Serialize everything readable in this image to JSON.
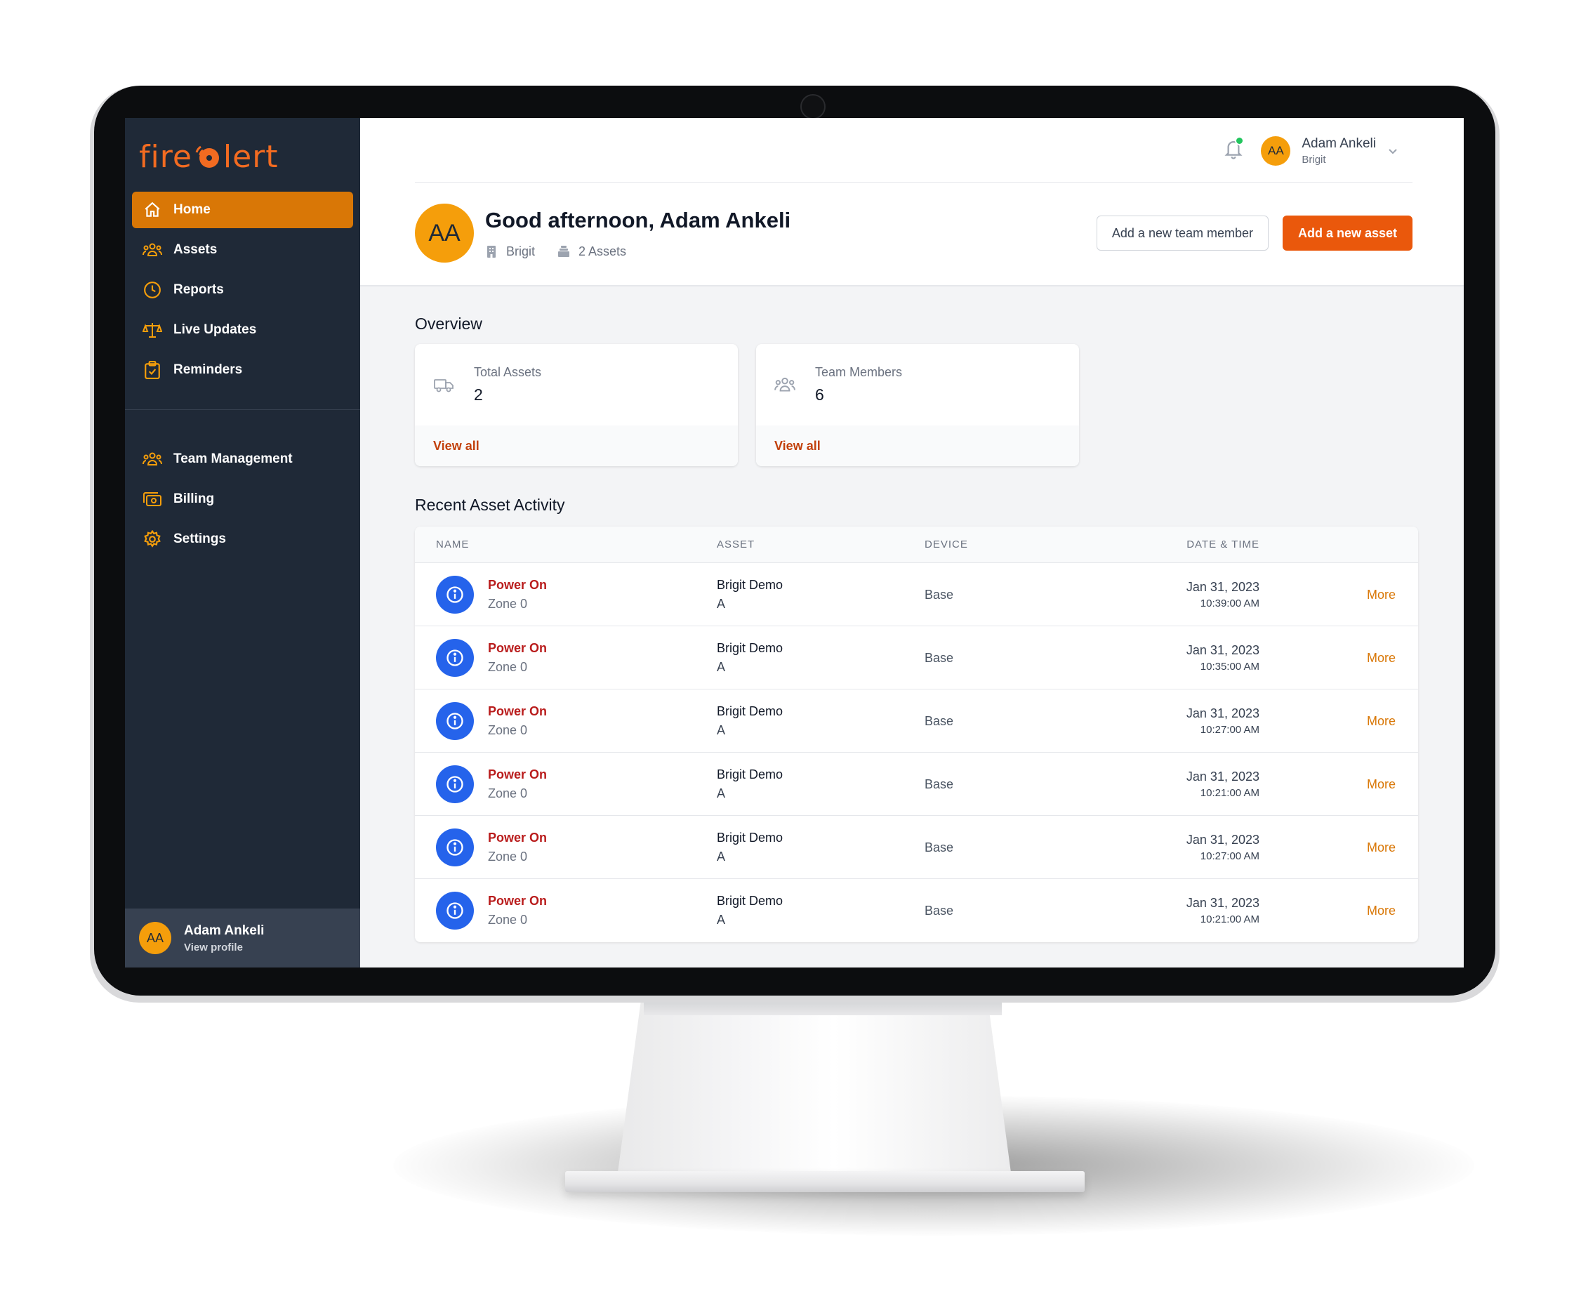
{
  "app": {
    "logo_text_left": "fire",
    "logo_text_right": "lert"
  },
  "sidebar": {
    "items": [
      {
        "label": "Home",
        "icon": "home-icon"
      },
      {
        "label": "Assets",
        "icon": "users-icon"
      },
      {
        "label": "Reports",
        "icon": "clock-icon"
      },
      {
        "label": "Live Updates",
        "icon": "scale-icon"
      },
      {
        "label": "Reminders",
        "icon": "clipboard-icon"
      }
    ],
    "items2": [
      {
        "label": "Team Management",
        "icon": "users-icon"
      },
      {
        "label": "Billing",
        "icon": "cash-icon"
      },
      {
        "label": "Settings",
        "icon": "gear-icon"
      }
    ],
    "user": {
      "initials": "AA",
      "name": "Adam Ankeli",
      "link": "View profile"
    }
  },
  "topbar": {
    "user": {
      "initials": "AA",
      "name": "Adam Ankeli",
      "org": "Brigit"
    }
  },
  "header": {
    "initials": "AA",
    "greeting": "Good afternoon, Adam Ankeli",
    "org": "Brigit",
    "assets_count": "2 Assets",
    "btn_team": "Add a new team member",
    "btn_asset": "Add a new asset"
  },
  "overview": {
    "title": "Overview",
    "cards": [
      {
        "label": "Total Assets",
        "value": "2",
        "link": "View all"
      },
      {
        "label": "Team Members",
        "value": "6",
        "link": "View all"
      }
    ]
  },
  "activity": {
    "title": "Recent Asset Activity",
    "columns": [
      "NAME",
      "ASSET",
      "DEVICE",
      "DATE & TIME"
    ],
    "rows": [
      {
        "event": "Power On",
        "zone": "Zone 0",
        "asset": "Brigit Demo",
        "asset_sub": "A",
        "device": "Base",
        "date": "Jan 31, 2023",
        "time": "10:39:00 AM",
        "more": "More"
      },
      {
        "event": "Power On",
        "zone": "Zone 0",
        "asset": "Brigit Demo",
        "asset_sub": "A",
        "device": "Base",
        "date": "Jan 31, 2023",
        "time": "10:35:00 AM",
        "more": "More"
      },
      {
        "event": "Power On",
        "zone": "Zone 0",
        "asset": "Brigit Demo",
        "asset_sub": "A",
        "device": "Base",
        "date": "Jan 31, 2023",
        "time": "10:27:00 AM",
        "more": "More"
      },
      {
        "event": "Power On",
        "zone": "Zone 0",
        "asset": "Brigit Demo",
        "asset_sub": "A",
        "device": "Base",
        "date": "Jan 31, 2023",
        "time": "10:21:00 AM",
        "more": "More"
      },
      {
        "event": "Power On",
        "zone": "Zone 0",
        "asset": "Brigit Demo",
        "asset_sub": "A",
        "device": "Base",
        "date": "Jan 31, 2023",
        "time": "10:27:00 AM",
        "more": "More"
      },
      {
        "event": "Power On",
        "zone": "Zone 0",
        "asset": "Brigit Demo",
        "asset_sub": "A",
        "device": "Base",
        "date": "Jan 31, 2023",
        "time": "10:21:00 AM",
        "more": "More"
      }
    ]
  },
  "colors": {
    "sidebar_bg": "#1f2937",
    "accent": "#d97706",
    "primary_button": "#ea580c",
    "event_text": "#b91c1c",
    "info_icon": "#2563eb",
    "notification_dot": "#22c55e"
  }
}
